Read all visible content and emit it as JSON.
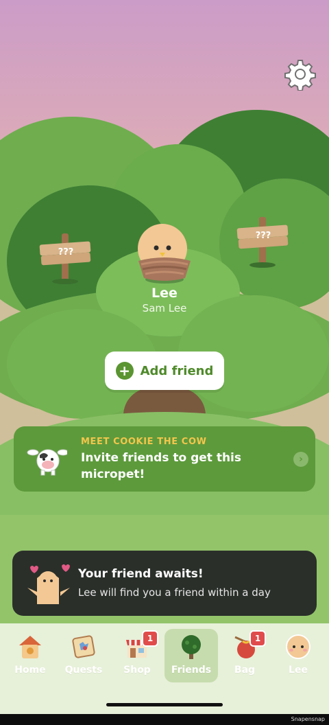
{
  "pet": {
    "name": "Lee",
    "owner": "Sam Lee"
  },
  "signs": {
    "left_text": "???",
    "right_text": "???"
  },
  "add_friend": {
    "label": "Add friend"
  },
  "invite_card": {
    "kicker": "MEET COOKIE THE COW",
    "title": "Invite friends to get this micropet!",
    "arrow": "›"
  },
  "await_card": {
    "title": "Your friend awaits!",
    "subtitle": "Lee will find you a friend within a day"
  },
  "tabs": [
    {
      "label": "Home",
      "icon": "house-icon",
      "active": false
    },
    {
      "label": "Quests",
      "icon": "quest-map-icon",
      "active": false
    },
    {
      "label": "Shop",
      "icon": "shop-icon",
      "active": false,
      "badge": "1"
    },
    {
      "label": "Friends",
      "icon": "tree-icon",
      "active": true
    },
    {
      "label": "Bag",
      "icon": "bag-icon",
      "active": false,
      "badge": "1"
    },
    {
      "label": "Lee",
      "icon": "pet-face-icon",
      "active": false
    }
  ],
  "watermark": "Snapensnap",
  "colors": {
    "accent": "#5a9532",
    "card_green": "#5d9a3c",
    "kicker_yellow": "#f4c64b",
    "badge_red": "#e04b4b",
    "dark_card": "#2a2f2a"
  }
}
